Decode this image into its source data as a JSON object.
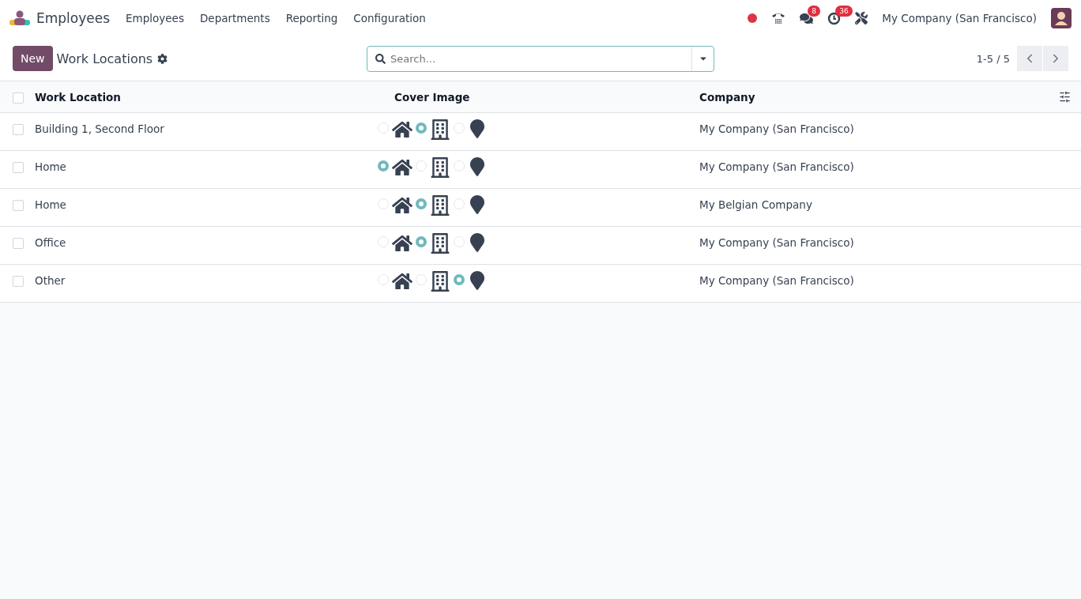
{
  "navbar": {
    "app_name": "Employees",
    "menu": [
      "Employees",
      "Departments",
      "Reporting",
      "Configuration"
    ],
    "messages_badge": "8",
    "activities_badge": "36",
    "company": "My Company (San Francisco)"
  },
  "control_panel": {
    "new_button": "New",
    "title": "Work Locations",
    "search": {
      "placeholder": "Search..."
    },
    "pager": "1-5 / 5"
  },
  "table": {
    "select_all_checked": false,
    "columns": [
      "Work Location",
      "Cover Image",
      "Company"
    ],
    "rows": [
      {
        "checked": false,
        "name": "Building 1, Second Floor",
        "company": "My Company (San Francisco)",
        "cover": [
          {
            "kind": "home",
            "selected": false
          },
          {
            "kind": "office",
            "selected": true
          },
          {
            "kind": "other",
            "selected": false
          }
        ]
      },
      {
        "checked": false,
        "name": "Home",
        "company": "My Company (San Francisco)",
        "cover": [
          {
            "kind": "home",
            "selected": true
          },
          {
            "kind": "office",
            "selected": false
          },
          {
            "kind": "other",
            "selected": false
          }
        ]
      },
      {
        "checked": false,
        "name": "Home",
        "company": "My Belgian Company",
        "cover": [
          {
            "kind": "home",
            "selected": false
          },
          {
            "kind": "office",
            "selected": true
          },
          {
            "kind": "other",
            "selected": false
          }
        ]
      },
      {
        "checked": false,
        "name": "Office",
        "company": "My Company (San Francisco)",
        "cover": [
          {
            "kind": "home",
            "selected": false
          },
          {
            "kind": "office",
            "selected": true
          },
          {
            "kind": "other",
            "selected": false
          }
        ]
      },
      {
        "checked": false,
        "name": "Other",
        "company": "My Company (San Francisco)",
        "cover": [
          {
            "kind": "home",
            "selected": false
          },
          {
            "kind": "office",
            "selected": false
          },
          {
            "kind": "other",
            "selected": true
          }
        ]
      }
    ]
  }
}
